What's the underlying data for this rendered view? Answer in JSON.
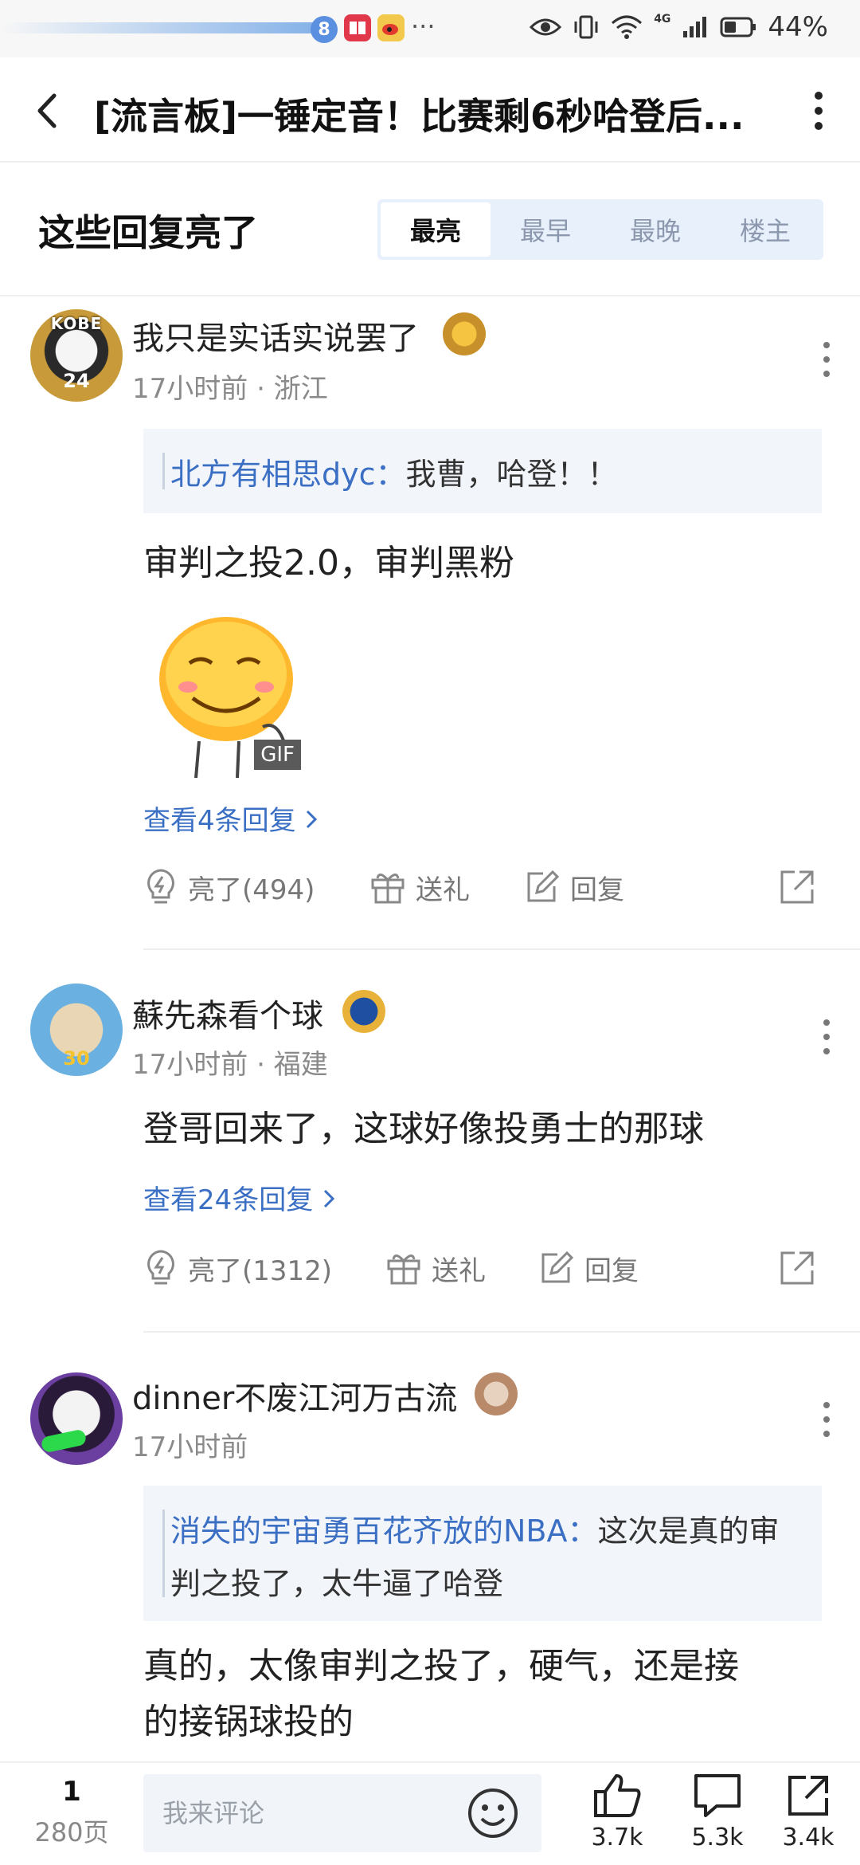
{
  "status_bar": {
    "badge_num": "8",
    "dots": "···",
    "net": "4G",
    "battery": "44%"
  },
  "header": {
    "title": "[流言板]一锤定音！比赛剩6秒哈登后..."
  },
  "section": {
    "title": "这些回复亮了",
    "tabs": [
      "最亮",
      "最早",
      "最晚",
      "楼主"
    ],
    "active_tab": "最亮"
  },
  "comments": [
    {
      "username": "我只是实话实说罢了",
      "avatar_text": "KOBE",
      "avatar_num": "24",
      "time": "17小时前",
      "location": "浙江",
      "quote_name": "北方有相思dyc：",
      "quote_text": "我曹，哈登！！",
      "text": "审判之投2.0，审判黑粉",
      "gif_label": "GIF",
      "view_replies": "查看4条回复",
      "like": "亮了(494)",
      "gift": "送礼",
      "reply": "回复"
    },
    {
      "username": "蘇先森看个球",
      "avatar_num": "30",
      "time": "17小时前",
      "location": "福建",
      "text": "登哥回来了，这球好像投勇士的那球",
      "view_replies": "查看24条回复",
      "like": "亮了(1312)",
      "gift": "送礼",
      "reply": "回复"
    },
    {
      "username": "dinner不废江河万古流",
      "time": "17小时前",
      "quote_name": "消失的宇宙勇百花齐放的NBA：",
      "quote_text": "这次是真的审判之投了，太牛逼了哈登",
      "text_line1": "真的，太像审判之投了，硬气，还是接",
      "text_line2": "的接锅球投的"
    }
  ],
  "bottom_bar": {
    "page_current": "1",
    "page_total": "280页",
    "comment_placeholder": "我来评论",
    "likes": "3.7k",
    "comments": "5.3k",
    "shares": "3.4k"
  },
  "colors": {
    "link_blue": "#3a6fc4",
    "segment_bg": "#e8f0fb",
    "quote_bg": "#f2f5fa"
  }
}
